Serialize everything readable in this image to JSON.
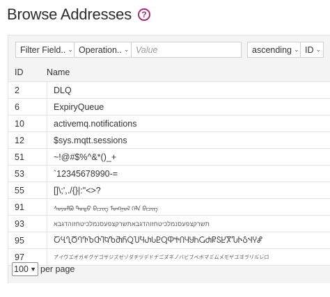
{
  "page": {
    "title": "Browse Addresses",
    "help_glyph": "?"
  },
  "toolbar": {
    "filter_field_label": "Filter Field..",
    "operation_label": "Operation..",
    "value_placeholder": "Value",
    "sort_order_label": "ascending",
    "sort_field_label": "ID"
  },
  "table": {
    "columns": [
      "ID",
      "Name"
    ],
    "rows": [
      {
        "id": "2",
        "name": "DLQ"
      },
      {
        "id": "6",
        "name": "ExpiryQueue"
      },
      {
        "id": "10",
        "name": "activemq.notifications"
      },
      {
        "id": "12",
        "name": "$sys.mqtt.sessions"
      },
      {
        "id": "51",
        "name": "~!@#$%^&*()_+"
      },
      {
        "id": "53",
        "name": "`12345678990-="
      },
      {
        "id": "55",
        "name": "[]\\;',./{}|:\"<>?"
      },
      {
        "id": "91",
        "name": "ᠰᠣᠶᠣᠮᠪᠣ ᠲᠣᠳᠣ ᠪᠢᠴᠢᠭ ᠮᠣᠩᠭᠣᠯ ᠬᠡᠯᠡ ᠪᠢᠴᠢᠭ"
      },
      {
        "id": "93",
        "name": "תשרקצפעסנמלכיטחזוהדגבאתשרקצפעסנמלכיטחזוהדגבא"
      },
      {
        "id": "95",
        "name": "ႠႡႢႣႤႥႦႧႨႩႪႫႬႭႮႯႰႱႲႳႴႵႶႷႸႹႺႻႼႽႾႿჀჁჂჃჄჅ"
      },
      {
        "id": "97",
        "name": "ア゙イ゙ヴエ゙オ゙ガギグゲゴザジズゼゾダヂヅデドナ゙ニ゙ヌ゙ネ゙ノ゙バビブベボマ゙ミ゙ム゙メ゙モ゙ヤ゙ユ゙ヨ゙ラ゙リ゙ル゙レ゙ロ゙"
      }
    ]
  },
  "pagination": {
    "per_page_value": "100",
    "per_page_label": "per page"
  },
  "colors": {
    "help_icon": "#a32a74",
    "panel_bg": "#f4f4f4"
  }
}
